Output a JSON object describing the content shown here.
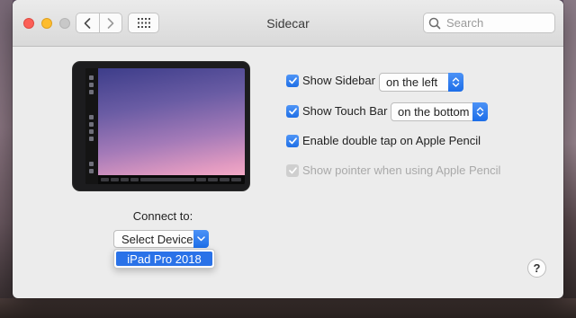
{
  "window": {
    "title": "Sidecar"
  },
  "search": {
    "placeholder": "Search"
  },
  "connect": {
    "label": "Connect to:",
    "selected": "Select Device",
    "options": [
      "iPad Pro 2018"
    ]
  },
  "options": {
    "show_sidebar": {
      "label": "Show Sidebar",
      "checked": true,
      "position": "on the left"
    },
    "show_touch_bar": {
      "label": "Show Touch Bar",
      "checked": true,
      "position": "on the bottom"
    },
    "double_tap": {
      "label": "Enable double tap on Apple Pencil",
      "checked": true
    },
    "show_pointer": {
      "label": "Show pointer when using Apple Pencil",
      "checked": true,
      "enabled": false
    }
  },
  "help": {
    "label": "?"
  },
  "colors": {
    "accent": "#1f6fe6",
    "window_bg": "#ececec",
    "close": "#fc5f57",
    "minimize": "#fdbc2e",
    "zoom_inactive": "#c8c8c8"
  },
  "icons": {
    "back": "chevron-left-icon",
    "forward": "chevron-right-icon",
    "show_all": "grid-icon",
    "search": "search-icon",
    "stepper": "updown-chevron-icon",
    "checkmark": "checkmark-icon"
  }
}
